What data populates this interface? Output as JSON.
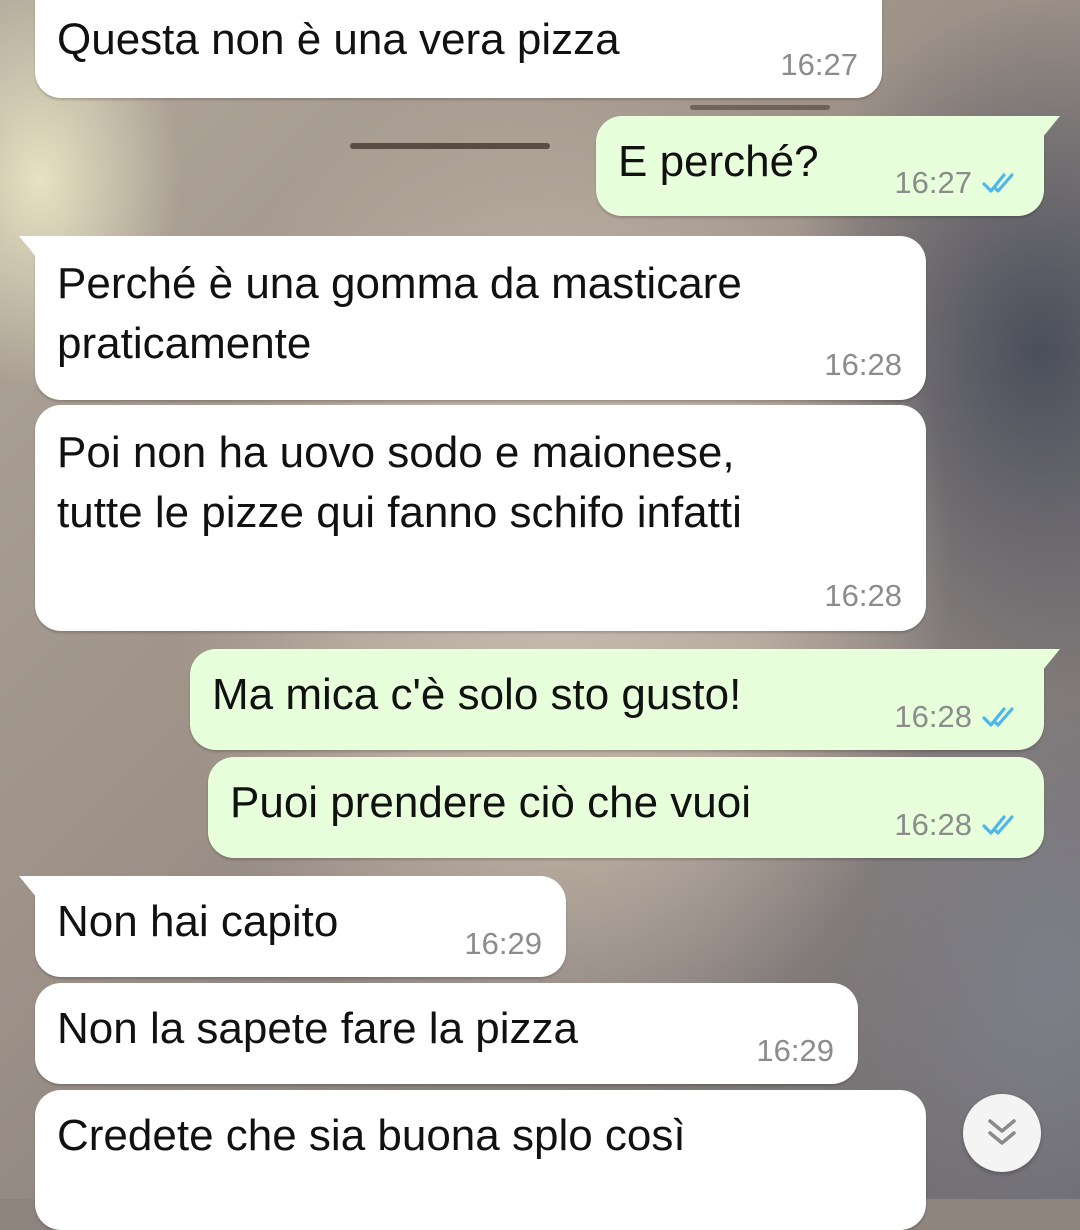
{
  "messages": [
    {
      "text": "Questa non è una vera pizza",
      "time": "16:27"
    },
    {
      "text": "E perché?",
      "time": "16:27"
    },
    {
      "text": "Perché è una gomma da masticare\npraticamente",
      "time": "16:28"
    },
    {
      "text": "Poi non ha uovo sodo e maionese,\ntutte le pizze qui fanno schifo infatti",
      "time": "16:28"
    },
    {
      "text": "Ma mica c'è solo sto gusto!",
      "time": "16:28"
    },
    {
      "text": "Puoi prendere ciò che vuoi",
      "time": "16:28"
    },
    {
      "text": "Non hai capito",
      "time": "16:29"
    },
    {
      "text": "Non la sapete fare la pizza",
      "time": "16:29"
    },
    {
      "text": "Credete che sia buona splo così",
      "time": ""
    }
  ],
  "colors": {
    "incoming_bubble": "#ffffff",
    "outgoing_bubble": "#e7ffdb",
    "read_ticks": "#4fb6ec",
    "timestamp": "#8c8c8c"
  },
  "icons": {
    "read_receipt": "double-check-icon",
    "scroll_down": "double-chevron-down-icon"
  }
}
